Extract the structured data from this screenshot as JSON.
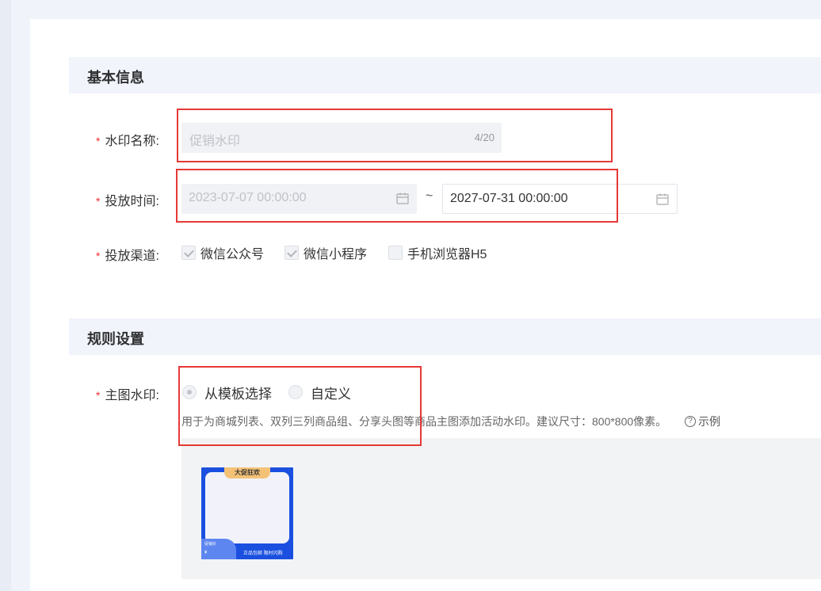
{
  "basic_info": {
    "title": "基本信息",
    "name_label": "水印名称:",
    "name_placeholder": "促销水印",
    "name_counter": "4/20",
    "time_label": "投放时间:",
    "start_time": "2023-07-07 00:00:00",
    "separator": "~",
    "end_time": "2027-07-31 00:00:00",
    "channel_label": "投放渠道:",
    "channels": [
      {
        "label": "微信公众号",
        "checked": true
      },
      {
        "label": "微信小程序",
        "checked": true
      },
      {
        "label": "手机浏览器H5",
        "checked": false
      }
    ]
  },
  "rule_settings": {
    "title": "规则设置",
    "main_image_label": "主图水印:",
    "options": [
      {
        "label": "从模板选择",
        "selected": true
      },
      {
        "label": "自定义",
        "selected": false
      }
    ],
    "hint": "用于为商城列表、双列三列商品组、分享头图等商品主图添加活动水印。建议尺寸：800*800像素。",
    "example_label": "示例",
    "example_icon": "?",
    "template_preview": {
      "tag": "大促狂欢",
      "price_label": "促销价",
      "currency": "¥",
      "bottom_text": "正品包邮 限时闪购"
    }
  },
  "required_mark": "*",
  "colors": {
    "required": "#f23030",
    "highlight_box": "#e53935",
    "template_blue": "#1a4fe0",
    "template_tag": "#f4c277"
  }
}
